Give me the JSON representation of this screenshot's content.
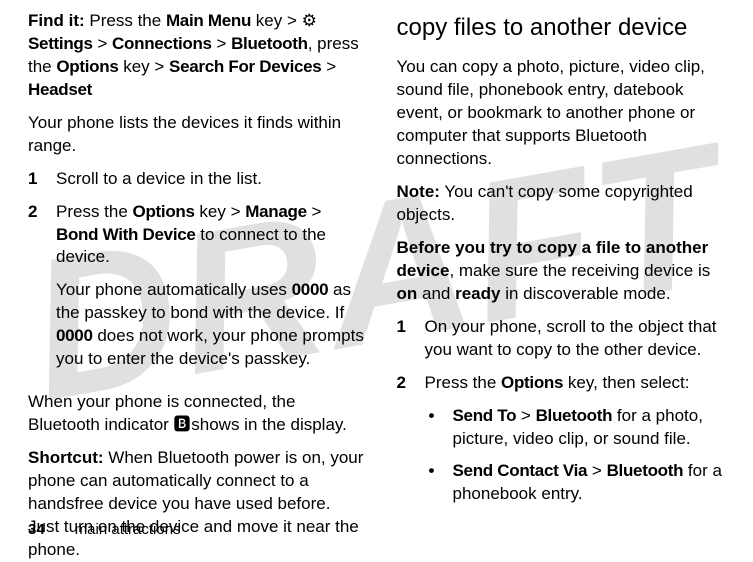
{
  "watermark": "DRAFT",
  "left": {
    "find_it_label": "Find it:",
    "find_it_1a": "Press the ",
    "find_it_mainmenu": "Main Menu",
    "find_it_1b": " key > ",
    "find_it_settings_icon": "⚙",
    "find_it_settings": " Settings",
    "find_it_gt1": " > ",
    "find_it_connections": "Connections",
    "find_it_gt2": " > ",
    "find_it_bluetooth": "Bluetooth",
    "find_it_2a": ", press the ",
    "find_it_options": "Options",
    "find_it_2b": " key > ",
    "find_it_search": "Search For Devices",
    "find_it_gt3": " > ",
    "find_it_headset": "Headset",
    "para1": "Your phone lists the devices it finds within range.",
    "step1_num": "1",
    "step1_text": "Scroll to a device in the list.",
    "step2_num": "2",
    "step2_a": "Press the ",
    "step2_options": "Options",
    "step2_b": " key > ",
    "step2_manage": "Manage",
    "step2_gt": " > ",
    "step2_bond": "Bond With Device",
    "step2_c": " to connect to the device.",
    "step2_p2a": "Your phone automatically uses ",
    "step2_0000a": "0000",
    "step2_p2b": " as the passkey to bond with the device. If ",
    "step2_0000b": "0000",
    "step2_p2c": " does not work, your phone prompts you to enter the device's passkey.",
    "para2a": "When your phone is connected, the Bluetooth indicator ",
    "bt_icon": "🅱",
    "para2b": " shows in the display.",
    "shortcut_label": "Shortcut:",
    "shortcut_text": " When Bluetooth power is on, your phone can automatically connect to a handsfree device you have used before. Just turn on the device and move it near the phone."
  },
  "right": {
    "heading": "copy files to another device",
    "para1": "You can copy a photo, picture, video clip, sound file, phonebook entry, datebook event, or bookmark to another phone or computer that supports Bluetooth connections.",
    "note_label": "Note:",
    "note_text": " You can't copy some copyrighted objects.",
    "before_a": "Before you try to copy a file to another device",
    "before_b": ", make sure the receiving device is ",
    "before_on": "on",
    "before_c": " and ",
    "before_ready": "ready",
    "before_d": " in discoverable mode.",
    "step1_num": "1",
    "step1_text": "On your phone, scroll to the object that you want to copy to the other device.",
    "step2_num": "2",
    "step2_a": "Press the ",
    "step2_options": "Options",
    "step2_b": " key, then select:",
    "bullet1_sendto": "Send To",
    "bullet1_gt": " > ",
    "bullet1_bt": "Bluetooth",
    "bullet1_text": " for a photo, picture, video clip, or sound file.",
    "bullet2_sendcontact": "Send Contact Via",
    "bullet2_gt": " > ",
    "bullet2_bt": "Bluetooth",
    "bullet2_text": " for a phonebook entry."
  },
  "footer": {
    "page": "34",
    "section": "main attractions"
  }
}
